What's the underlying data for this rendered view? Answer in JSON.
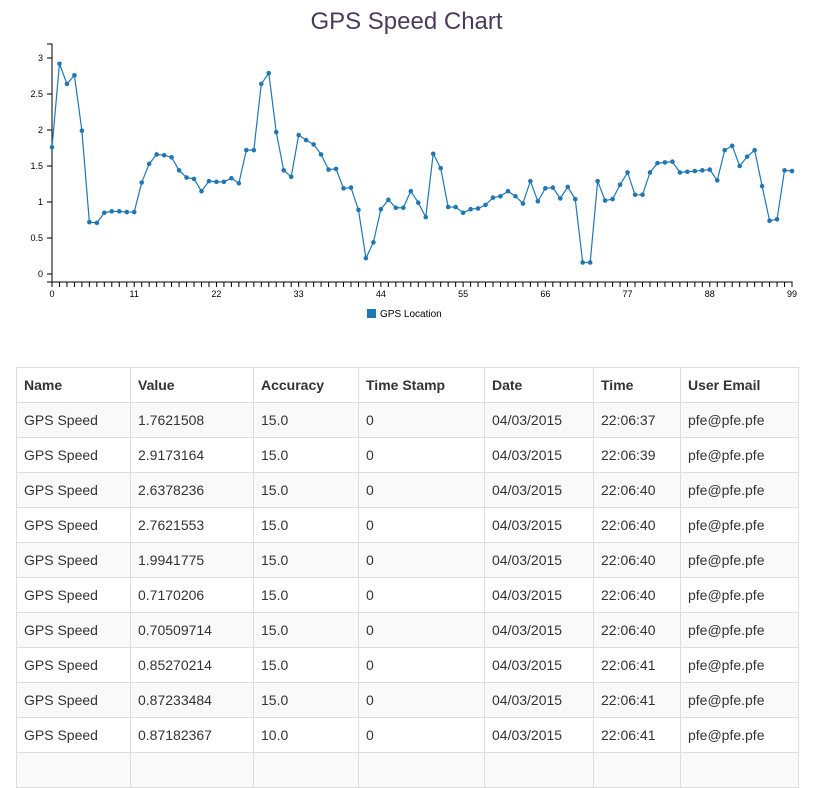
{
  "chart_data": {
    "type": "line",
    "title": "GPS Speed Chart",
    "xlabel": "",
    "ylabel": "",
    "xlim": [
      0,
      99
    ],
    "ylim": [
      0,
      3
    ],
    "xticks": [
      0,
      11,
      22,
      33,
      44,
      55,
      66,
      77,
      88,
      99
    ],
    "yticks": [
      0,
      0.5,
      1,
      1.5,
      2,
      2.5,
      3
    ],
    "ytick_labels": [
      "0",
      "0.5",
      "1",
      "1.5",
      "2",
      "2.5",
      "3"
    ],
    "legend_position": "bottom",
    "series": [
      {
        "name": "GPS Location",
        "color": "#1f77b4",
        "x": [
          0,
          1,
          2,
          3,
          4,
          5,
          6,
          7,
          8,
          9,
          10,
          11,
          12,
          13,
          14,
          15,
          16,
          17,
          18,
          19,
          20,
          21,
          22,
          23,
          24,
          25,
          26,
          27,
          28,
          29,
          30,
          31,
          32,
          33,
          34,
          35,
          36,
          37,
          38,
          39,
          40,
          41,
          42,
          43,
          44,
          45,
          46,
          47,
          48,
          49,
          50,
          51,
          52,
          53,
          54,
          55,
          56,
          57,
          58,
          59,
          60,
          61,
          62,
          63,
          64,
          65,
          66,
          67,
          68,
          69,
          70,
          71,
          72,
          73,
          74,
          75,
          76,
          77,
          78,
          79,
          80,
          81,
          82,
          83,
          84,
          85,
          86,
          87,
          88,
          89,
          90,
          91,
          92,
          93,
          94,
          95,
          96,
          97,
          98,
          99
        ],
        "values": [
          1.76,
          2.92,
          2.64,
          2.76,
          1.99,
          0.72,
          0.71,
          0.85,
          0.87,
          0.87,
          0.86,
          0.86,
          1.27,
          1.53,
          1.66,
          1.65,
          1.62,
          1.44,
          1.34,
          1.32,
          1.15,
          1.29,
          1.28,
          1.28,
          1.33,
          1.26,
          1.72,
          1.72,
          2.64,
          2.79,
          1.97,
          1.44,
          1.35,
          1.93,
          1.86,
          1.8,
          1.66,
          1.45,
          1.46,
          1.19,
          1.2,
          0.89,
          0.22,
          0.44,
          0.9,
          1.03,
          0.92,
          0.92,
          1.15,
          0.99,
          0.79,
          1.67,
          1.47,
          0.93,
          0.93,
          0.85,
          0.9,
          0.91,
          0.96,
          1.06,
          1.08,
          1.15,
          1.08,
          0.98,
          1.29,
          1.01,
          1.19,
          1.2,
          1.05,
          1.21,
          1.04,
          0.16,
          0.16,
          1.29,
          1.02,
          1.04,
          1.24,
          1.41,
          1.1,
          1.1,
          1.41,
          1.54,
          1.55,
          1.56,
          1.41,
          1.42,
          1.43,
          1.44,
          1.45,
          1.3,
          1.72,
          1.78,
          1.5,
          1.63,
          1.72,
          1.22,
          0.74,
          0.76,
          1.44,
          1.43
        ]
      }
    ]
  },
  "table": {
    "headers": [
      "Name",
      "Value",
      "Accuracy",
      "Time Stamp",
      "Date",
      "Time",
      "User Email"
    ],
    "rows": [
      [
        "GPS Speed",
        "1.7621508",
        "15.0",
        "0",
        "04/03/2015",
        "22:06:37",
        "pfe@pfe.pfe"
      ],
      [
        "GPS Speed",
        "2.9173164",
        "15.0",
        "0",
        "04/03/2015",
        "22:06:39",
        "pfe@pfe.pfe"
      ],
      [
        "GPS Speed",
        "2.6378236",
        "15.0",
        "0",
        "04/03/2015",
        "22:06:40",
        "pfe@pfe.pfe"
      ],
      [
        "GPS Speed",
        "2.7621553",
        "15.0",
        "0",
        "04/03/2015",
        "22:06:40",
        "pfe@pfe.pfe"
      ],
      [
        "GPS Speed",
        "1.9941775",
        "15.0",
        "0",
        "04/03/2015",
        "22:06:40",
        "pfe@pfe.pfe"
      ],
      [
        "GPS Speed",
        "0.7170206",
        "15.0",
        "0",
        "04/03/2015",
        "22:06:40",
        "pfe@pfe.pfe"
      ],
      [
        "GPS Speed",
        "0.70509714",
        "15.0",
        "0",
        "04/03/2015",
        "22:06:40",
        "pfe@pfe.pfe"
      ],
      [
        "GPS Speed",
        "0.85270214",
        "15.0",
        "0",
        "04/03/2015",
        "22:06:41",
        "pfe@pfe.pfe"
      ],
      [
        "GPS Speed",
        "0.87233484",
        "15.0",
        "0",
        "04/03/2015",
        "22:06:41",
        "pfe@pfe.pfe"
      ],
      [
        "GPS Speed",
        "0.87182367",
        "10.0",
        "0",
        "04/03/2015",
        "22:06:41",
        "pfe@pfe.pfe"
      ],
      [
        "",
        "",
        "",
        "",
        "",
        "",
        ""
      ]
    ]
  }
}
